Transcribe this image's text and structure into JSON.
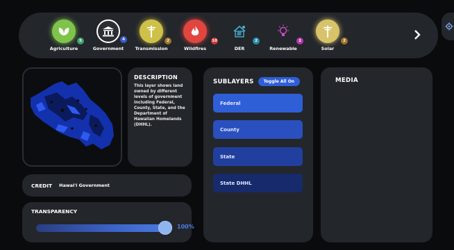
{
  "categories": [
    {
      "label": "Agriculture",
      "count": "5",
      "icon": "leaf-icon",
      "color": "#7ec44a",
      "badge_color": "#3f9f6b"
    },
    {
      "label": "Government",
      "count": "4",
      "icon": "government-building-icon",
      "color": "#2b2e33",
      "badge_color": "#3b5bd0"
    },
    {
      "label": "Transmission",
      "count": "2",
      "icon": "power-pole-icon",
      "color": "#cfc04a",
      "badge_color": "#a3742c"
    },
    {
      "label": "Wildfires",
      "count": "10",
      "icon": "fire-icon",
      "color": "#e0463f",
      "badge_color": "#c53b33"
    },
    {
      "label": "DER",
      "count": "2",
      "icon": "solar-house-icon",
      "color": "#23262b",
      "badge_color": "#2a8fa8"
    },
    {
      "label": "Renewable",
      "count": "2",
      "icon": "lightbulb-icon",
      "color": "#23262b",
      "badge_color": "#b03aa8"
    },
    {
      "label": "Solar",
      "count": "2",
      "icon": "solar-pole-icon",
      "color": "#d8c36a",
      "badge_color": "#a3742c"
    }
  ],
  "nav": {
    "next_icon": "chevron-right-icon",
    "settings_icon": "gear-icon"
  },
  "description": {
    "title": "DESCRIPTION",
    "text": "This layer shows land owned by different levels of government including Federal, County, State, and the Department of Hawaiian Homelands (DHHL)."
  },
  "credit": {
    "label": "CREDIT",
    "value": "Hawai'i Government"
  },
  "transparency": {
    "label": "TRANSPARENCY",
    "value_text": "100%",
    "value": 1.0
  },
  "sublayers": {
    "title": "SUBLAYERS",
    "toggle_label": "Toggle All On",
    "items": [
      {
        "label": "Federal",
        "color": "#2f5fd6"
      },
      {
        "label": "County",
        "color": "#2a4fbf"
      },
      {
        "label": "State",
        "color": "#213f9f"
      },
      {
        "label": "State DHHL",
        "color": "#172a6b"
      }
    ]
  },
  "media": {
    "title": "MEDIA"
  }
}
